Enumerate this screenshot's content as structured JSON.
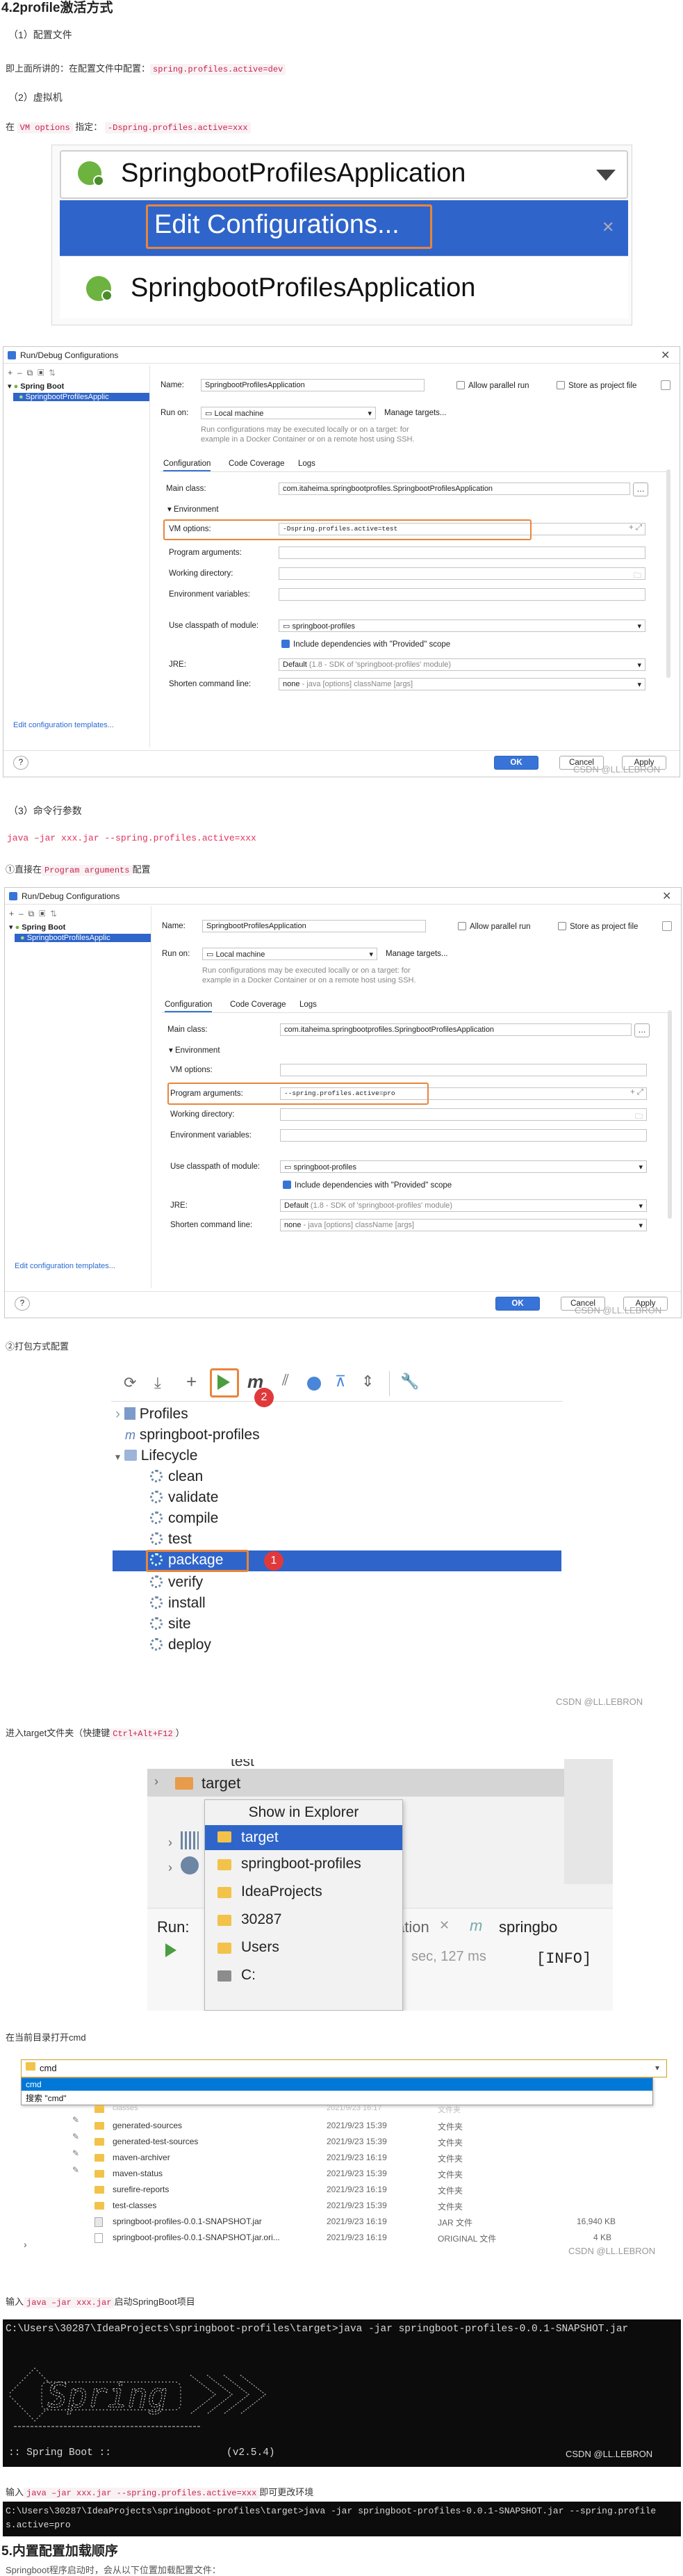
{
  "s1": {
    "title": "4.2profile激活方式",
    "h1": "（1）配置文件",
    "p1": "即上面所讲的：在配置文件中配置：",
    "c1": "spring.profiles.active=dev",
    "h2": "（2）虚拟机",
    "p2a": "在",
    "c2a": "VM options",
    "p2b": "指定：",
    "c2b": "-Dspring.profiles.active=xxx"
  },
  "img1": {
    "top": "SpringbootProfilesApplication",
    "edit": "Edit Configurations...",
    "bottom": "SpringbootProfilesApplication",
    "ghost": "r"
  },
  "dlg1": {
    "title": "Run/Debug Configurations",
    "tree_root": "Spring Boot",
    "tree_item": "SpringbootProfilesApplic",
    "name_label": "Name:",
    "name_value": "SpringbootProfilesApplication",
    "allow_parallel": "Allow parallel run",
    "store_file": "Store as project file",
    "run_on_label": "Run on:",
    "run_on_value": "Local machine",
    "manage": "Manage targets...",
    "hint1": "Run configurations may be executed locally or on a target: for",
    "hint2": "example in a Docker Container or on a remote host using SSH.",
    "tabs": [
      "Configuration",
      "Code Coverage",
      "Logs"
    ],
    "main_class_label": "Main class:",
    "main_class": "com.itaheima.springbootprofiles.SpringbootProfilesApplication",
    "env": "Environment",
    "vm_label": "VM options:",
    "vm_value": "-Dspring.profiles.active=test",
    "prog_label": "Program arguments:",
    "prog_value": "",
    "wd_label": "Working directory:",
    "env_label": "Environment variables:",
    "cp_label": "Use classpath of module:",
    "cp_value": "springboot-profiles",
    "include": "Include dependencies with \"Provided\" scope",
    "jre_label": "JRE:",
    "jre_value": "Default",
    "jre_hint": "(1.8 - SDK of 'springboot-profiles' module)",
    "short_label": "Shorten command line:",
    "short_value": "none",
    "short_hint": "- java [options] className [args]",
    "edit_templates": "Edit configuration templates...",
    "ok": "OK",
    "cancel": "Cancel",
    "apply": "Apply",
    "help": "?",
    "wm": "CSDN @LL.LEBRON"
  },
  "s2": {
    "h3": "（3）命令行参数",
    "cmd": "java –jar xxx.jar --spring.profiles.active=xxx",
    "p1a": "①直接在",
    "c1": "Program arguments",
    "p1b": "配置"
  },
  "dlg2": {
    "title": "Run/Debug Configurations",
    "tree_root": "Spring Boot",
    "tree_item": "SpringbootProfilesApplic",
    "name_label": "Name:",
    "name_value": "SpringbootProfilesApplication",
    "allow_parallel": "Allow parallel run",
    "store_file": "Store as project file",
    "run_on_label": "Run on:",
    "run_on_value": "Local machine",
    "manage": "Manage targets...",
    "hint1": "Run configurations may be executed locally or on a target: for",
    "hint2": "example in a Docker Container or on a remote host using SSH.",
    "tabs": [
      "Configuration",
      "Code Coverage",
      "Logs"
    ],
    "main_class_label": "Main class:",
    "main_class": "com.itaheima.springbootprofiles.SpringbootProfilesApplication",
    "env": "Environment",
    "vm_label": "VM options:",
    "vm_value": "",
    "prog_label": "Program arguments:",
    "prog_value": "--spring.profiles.active=pro",
    "wd_label": "Working directory:",
    "env_label": "Environment variables:",
    "cp_label": "Use classpath of module:",
    "cp_value": "springboot-profiles",
    "include": "Include dependencies with \"Provided\" scope",
    "jre_label": "JRE:",
    "jre_value": "Default",
    "jre_hint": "(1.8 - SDK of 'springboot-profiles' module)",
    "short_label": "Shorten command line:",
    "short_value": "none",
    "short_hint": "- java [options] className [args]",
    "edit_templates": "Edit configuration templates...",
    "ok": "OK",
    "cancel": "Cancel",
    "apply": "Apply",
    "help": "?",
    "wm": "CSDN @LL.LEBRON"
  },
  "s3": {
    "p": "②打包方式配置"
  },
  "maven": {
    "m": "m",
    "badge2": "2",
    "badge1": "1",
    "profiles": "Profiles",
    "project": "springboot-profiles",
    "lifecycle": "Lifecycle",
    "goals": [
      "clean",
      "validate",
      "compile",
      "test",
      "package",
      "verify",
      "install",
      "site",
      "deploy"
    ],
    "wm": "CSDN @LL.LEBRON"
  },
  "s4": {
    "p_a": "进入target文件夹（快捷键",
    "c": "Ctrl+Alt+F12",
    "p_b": "）"
  },
  "explorer": {
    "top": "test",
    "target": "target",
    "menu_title": "Show in Explorer",
    "items": [
      "target",
      "springboot-profiles",
      "IdeaProjects",
      "30287",
      "Users",
      "C:"
    ],
    "run": "Run:",
    "ation": "ation",
    "spring": "springbo",
    "time": "sec, 127 ms",
    "info": "[INFO]"
  },
  "s5": {
    "p": "在当前目录打开cmd"
  },
  "cmdwin": {
    "input": "cmd",
    "sel": "cmd",
    "search": "搜索 \"cmd\"",
    "files": [
      [
        "classes",
        "2021/9/23 16:17",
        "文件夹",
        ""
      ],
      [
        "generated-sources",
        "2021/9/23 15:39",
        "文件夹",
        ""
      ],
      [
        "generated-test-sources",
        "2021/9/23 15:39",
        "文件夹",
        ""
      ],
      [
        "maven-archiver",
        "2021/9/23 16:19",
        "文件夹",
        ""
      ],
      [
        "maven-status",
        "2021/9/23 15:39",
        "文件夹",
        ""
      ],
      [
        "surefire-reports",
        "2021/9/23 16:19",
        "文件夹",
        ""
      ],
      [
        "test-classes",
        "2021/9/23 15:39",
        "文件夹",
        ""
      ],
      [
        "springboot-profiles-0.0.1-SNAPSHOT.jar",
        "2021/9/23 16:19",
        "JAR 文件",
        "16,940 KB"
      ],
      [
        "springboot-profiles-0.0.1-SNAPSHOT.jar.ori...",
        "2021/9/23 16:19",
        "ORIGINAL 文件",
        "4 KB"
      ]
    ],
    "wm": "CSDN @LL.LEBRON"
  },
  "s6": {
    "pa": "输入",
    "c": "java –jar xxx.jar",
    "pb": "启动SpringBoot项目"
  },
  "term1": {
    "cmd": "C:\\Users\\30287\\IdeaProjects\\springboot-profiles\\target>java -jar springboot-profiles-0.0.1-SNAPSHOT.jar",
    "boot": ":: Spring Boot ::",
    "ver": "(v2.5.4)",
    "wm": "CSDN @LL.LEBRON"
  },
  "s7": {
    "pa": "输入",
    "c": "java –jar xxx.jar --spring.profiles.active=xxx",
    "pb": "即可更改环境"
  },
  "term2": {
    "line1": "C:\\Users\\30287\\IdeaProjects\\springboot-profiles\\target>java -jar springboot-profiles-0.0.1-SNAPSHOT.jar --spring.profile",
    "line2": "s.active=pro"
  },
  "s8": {
    "title": "5.内置配置加载顺序",
    "p": "Springboot程序启动时，会从以下位置加载配置文件："
  }
}
